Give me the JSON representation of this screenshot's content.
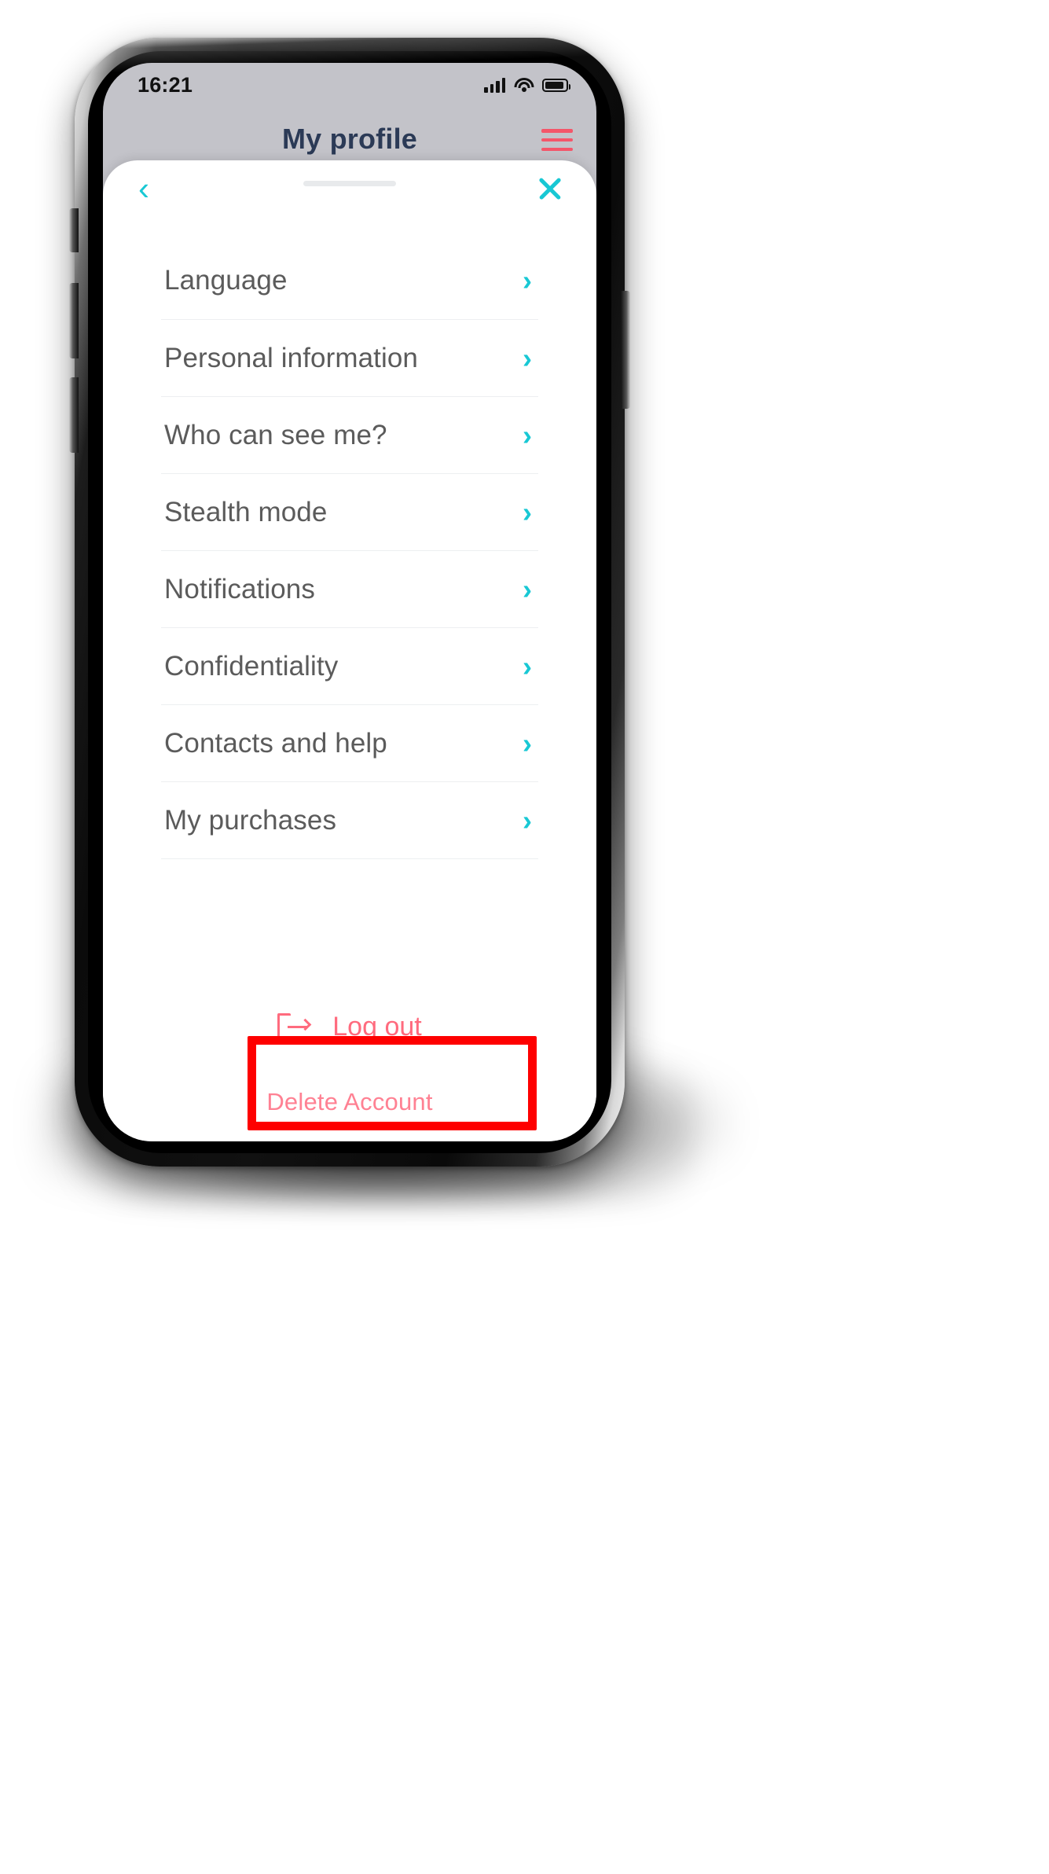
{
  "status_bar": {
    "time": "16:21",
    "signal_icon": "cellular-signal-icon",
    "wifi_icon": "wifi-icon",
    "battery_icon": "battery-icon"
  },
  "background_page": {
    "title": "My profile",
    "menu_icon": "hamburger-menu-icon"
  },
  "sheet": {
    "back_icon": "chevron-left-icon",
    "close_icon": "close-x-icon",
    "drag_handle": "drag-handle",
    "items": [
      {
        "label": "Language",
        "arrow": "chevron-right-icon"
      },
      {
        "label": "Personal information",
        "arrow": "chevron-right-icon"
      },
      {
        "label": "Who can see me?",
        "arrow": "chevron-right-icon"
      },
      {
        "label": "Stealth mode",
        "arrow": "chevron-right-icon"
      },
      {
        "label": "Notifications",
        "arrow": "chevron-right-icon"
      },
      {
        "label": "Confidentiality",
        "arrow": "chevron-right-icon"
      },
      {
        "label": "Contacts and help",
        "arrow": "chevron-right-icon"
      },
      {
        "label": "My purchases",
        "arrow": "chevron-right-icon"
      }
    ],
    "logout": {
      "label": "Log out",
      "icon": "logout-exit-icon"
    },
    "delete_account": {
      "label": "Delete Account"
    }
  },
  "annotation": {
    "shape": "rectangle",
    "color": "#fe0000",
    "targets": "Delete Account"
  },
  "colors": {
    "accent_cyan": "#18c8d4",
    "accent_pink": "#ff6b7e",
    "delete_pink": "#ff8193",
    "title_navy": "#2b3a56",
    "label_gray": "#5b5b5b",
    "divider": "#edeff1",
    "page_bg": "#c3c3c9",
    "annotation_red": "#fe0000"
  }
}
